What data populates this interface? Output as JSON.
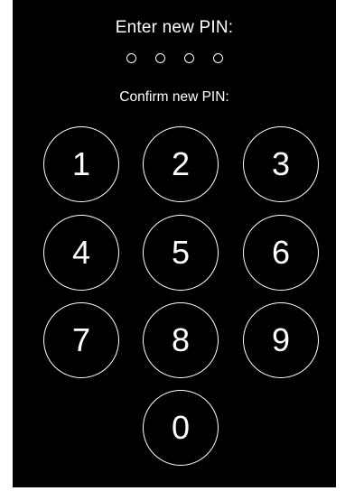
{
  "pin_screen": {
    "title": "Enter new PIN:",
    "confirm_label": "Confirm new PIN:",
    "entered_digits": 0,
    "pin_length": 4
  },
  "keypad": {
    "keys": [
      "1",
      "2",
      "3",
      "4",
      "5",
      "6",
      "7",
      "8",
      "9",
      "0"
    ]
  },
  "colors": {
    "background": "#000000",
    "foreground": "#ffffff"
  }
}
